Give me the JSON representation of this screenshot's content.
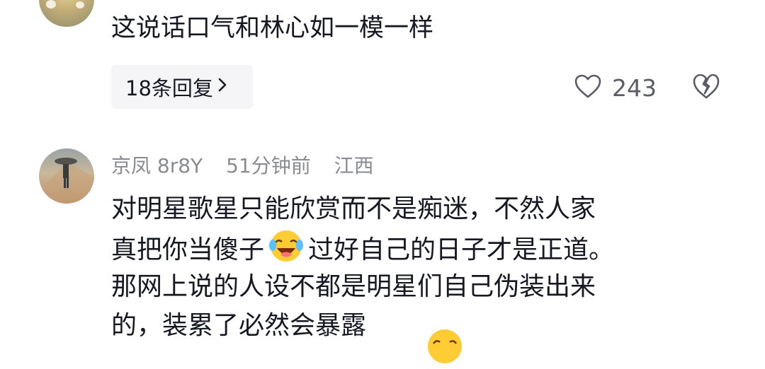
{
  "comment1": {
    "text": "这说话口气和林心如一模一样",
    "reply_label": "18条回复",
    "like_count": "243",
    "like_icon": "heart-outline-icon",
    "dislike_icon": "broken-heart-icon"
  },
  "comment2": {
    "username": "京凤 8r8Y",
    "time": "51分钟前",
    "location": "江西",
    "line1": "对明星歌星只能欣赏而不是痴迷，不然人家",
    "line2_a": "真把你当傻子",
    "line2_emoji": "laughing-crying-emoji",
    "line2_b": "过好自己的日子才是正道。",
    "line3": "那网上说的人设不都是明星们自己伪装出来",
    "line4_partial": "的，装累了必然会暴露"
  },
  "colors": {
    "text": "#161823",
    "meta": "#8a8b91",
    "pill_bg": "#f5f5f7",
    "icon": "#5b5c66"
  }
}
